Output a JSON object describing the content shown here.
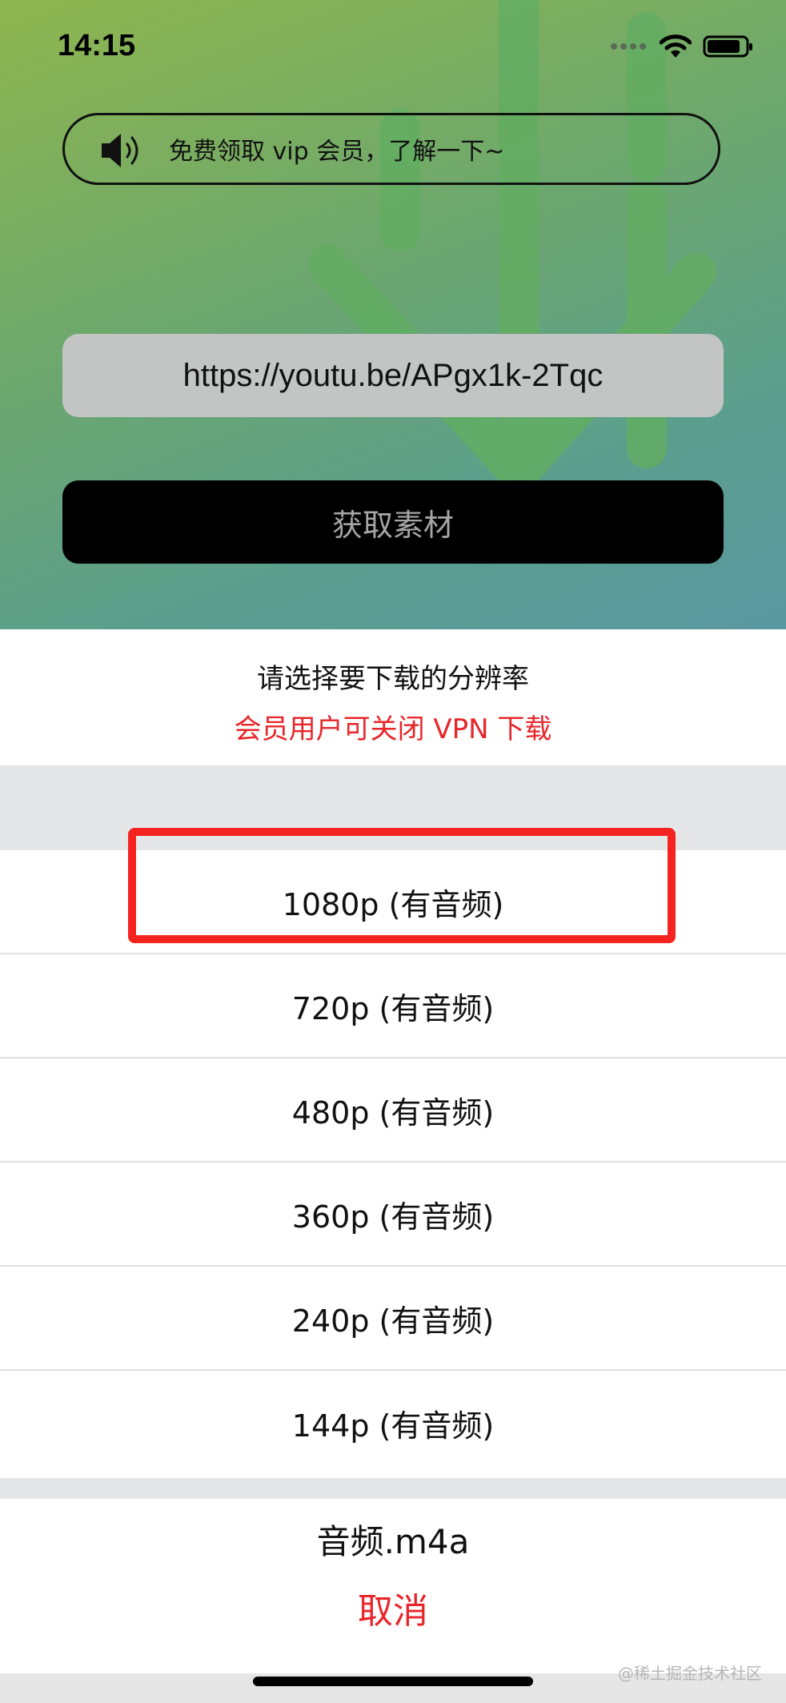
{
  "status_bar": {
    "time": "14:15"
  },
  "notice": {
    "text": "免费领取 vip 会员，了解一下~"
  },
  "url_input": {
    "value": "https://youtu.be/APgx1k-2Tqc"
  },
  "fetch_button": {
    "label": "获取素材"
  },
  "sheet": {
    "title": "请选择要下载的分辨率",
    "subtitle": "会员用户可关闭 VPN 下载",
    "options": [
      {
        "label": "1080p (有音频)"
      },
      {
        "label": "720p (有音频)"
      },
      {
        "label": "480p (有音频)"
      },
      {
        "label": "360p (有音频)"
      },
      {
        "label": "240p (有音频)"
      },
      {
        "label": "144p (有音频)"
      }
    ],
    "audio_option": "音频.m4a",
    "cancel": "取消"
  },
  "watermark": "@稀土掘金技术社区",
  "colors": {
    "accent_red": "#e8262a",
    "highlight_red": "#f5231f",
    "button_black": "#000000"
  }
}
